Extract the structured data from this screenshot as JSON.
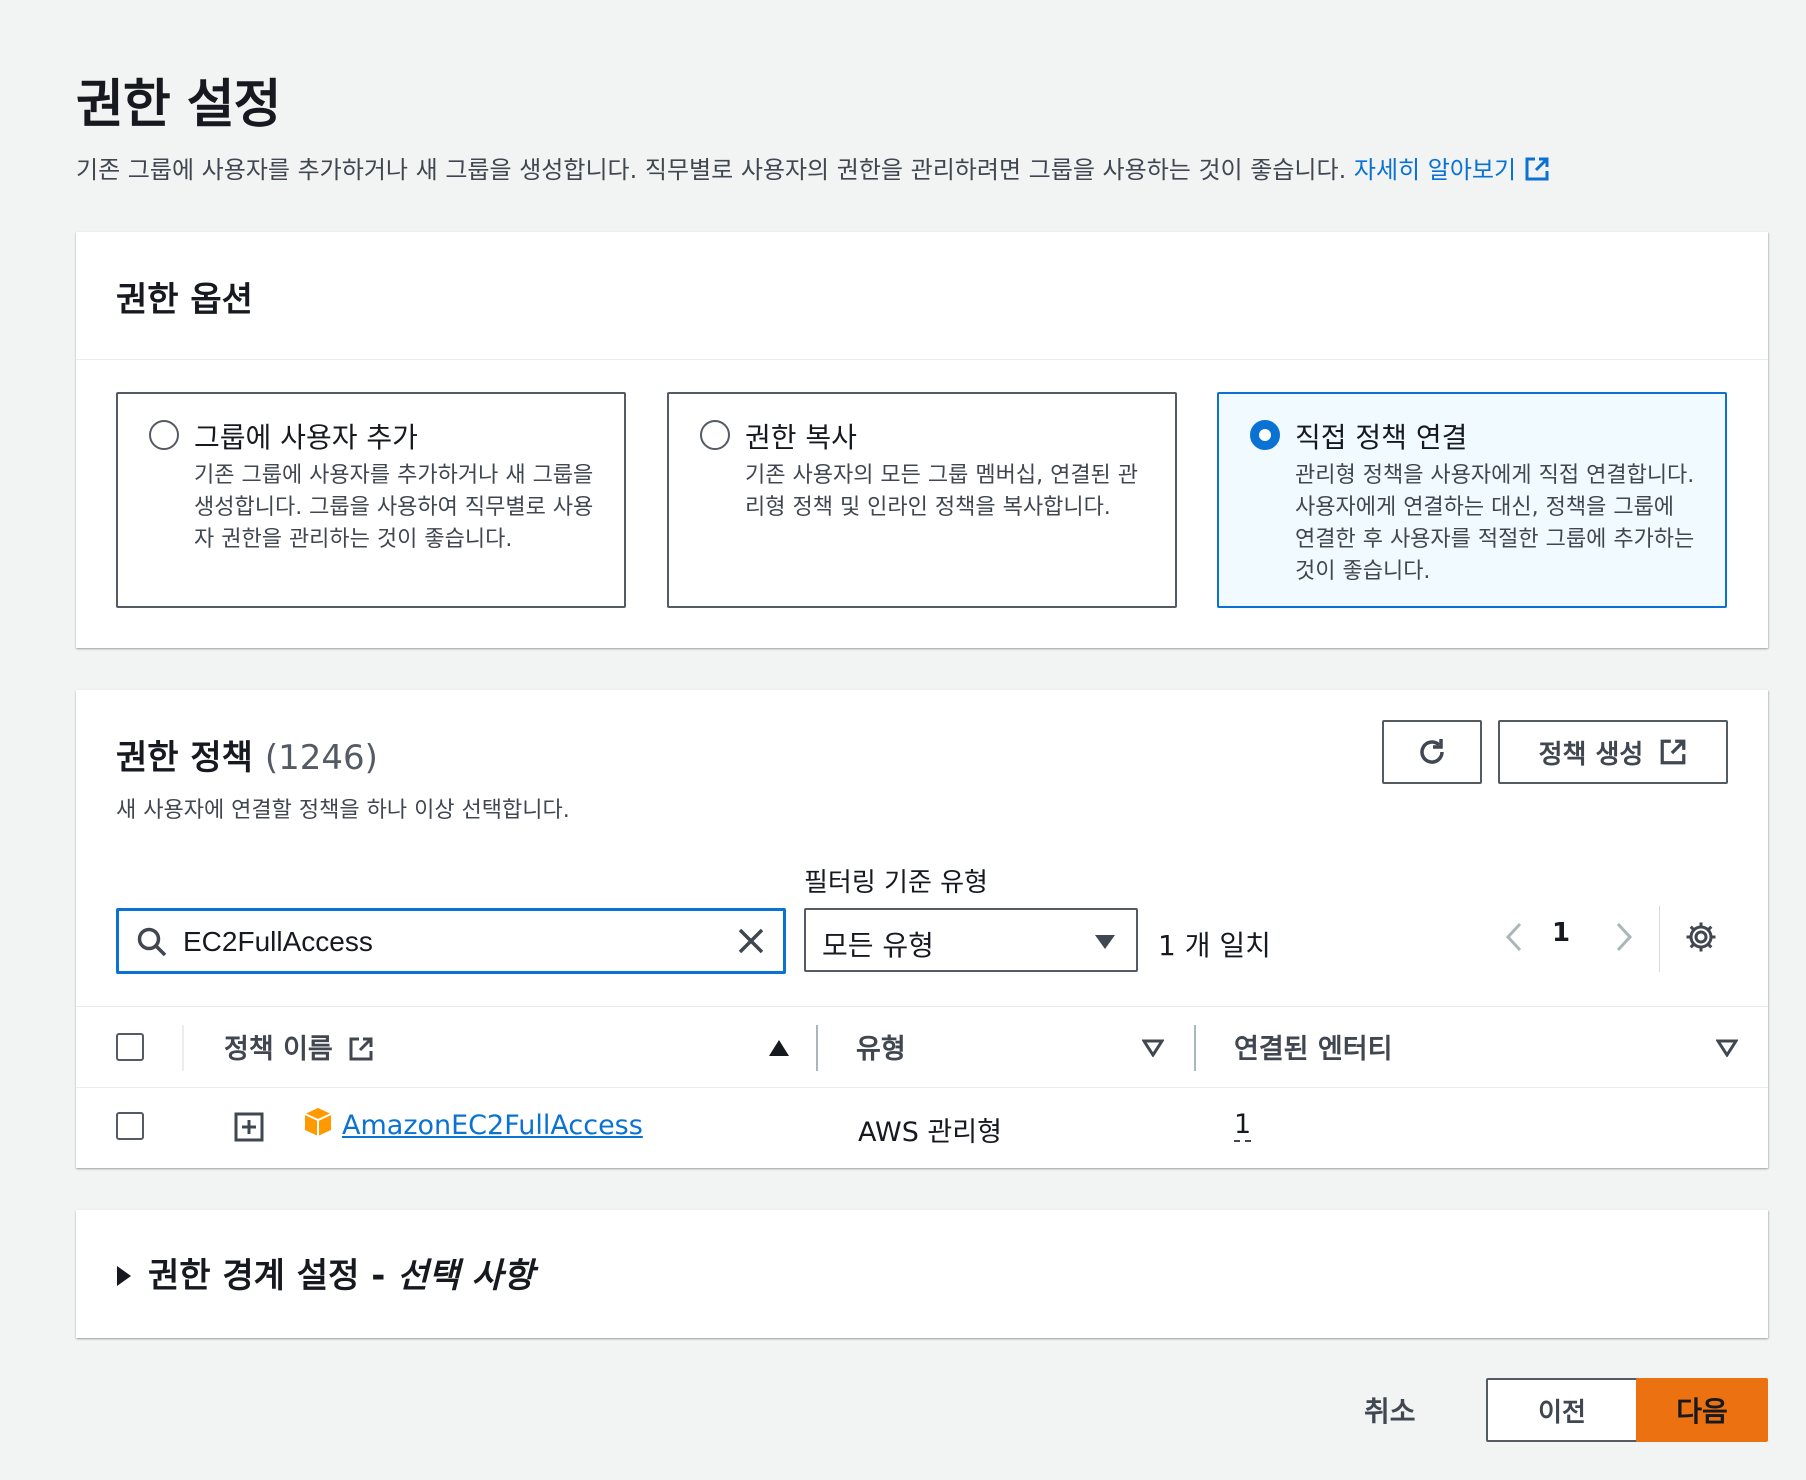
{
  "page": {
    "title": "권한 설정",
    "description": "기존 그룹에 사용자를 추가하거나 새 그룹을 생성합니다. 직무별로 사용자의 권한을 관리하려면 그룹을 사용하는 것이 좋습니다.",
    "learn_more": "자세히 알아보기"
  },
  "options": {
    "heading": "권한 옵션",
    "tiles": [
      {
        "title": "그룹에 사용자 추가",
        "desc": "기존 그룹에 사용자를 추가하거나 새 그룹을 생성합니다. 그룹을 사용하여 직무별로 사용자 권한을 관리하는 것이 좋습니다.",
        "selected": false
      },
      {
        "title": "권한 복사",
        "desc": "기존 사용자의 모든 그룹 멤버십, 연결된 관리형 정책 및 인라인 정책을 복사합니다.",
        "selected": false
      },
      {
        "title": "직접 정책 연결",
        "desc": "관리형 정책을 사용자에게 직접 연결합니다. 사용자에게 연결하는 대신, 정책을 그룹에 연결한 후 사용자를 적절한 그룹에 추가하는 것이 좋습니다.",
        "selected": true
      }
    ]
  },
  "policies": {
    "heading": "권한 정책",
    "count": "(1246)",
    "subtitle": "새 사용자에 연결할 정책을 하나 이상 선택합니다.",
    "create_button": "정책 생성",
    "filter_label": "필터링 기준 유형",
    "search_value": "EC2FullAccess",
    "type_filter": "모든 유형",
    "match_text": "1 개 일치",
    "page_number": "1",
    "columns": {
      "name": "정책 이름",
      "type": "유형",
      "entities": "연결된 엔터티"
    },
    "rows": [
      {
        "name": "AmazonEC2FullAccess",
        "type": "AWS 관리형",
        "entities": "1"
      }
    ]
  },
  "boundary": {
    "title": "권한 경계 설정 - ",
    "optional": "선택 사항"
  },
  "footer": {
    "cancel": "취소",
    "previous": "이전",
    "next": "다음"
  },
  "colors": {
    "accent": "#0972d3",
    "primary_button": "#ec7211",
    "aws_icon": "#f90"
  }
}
